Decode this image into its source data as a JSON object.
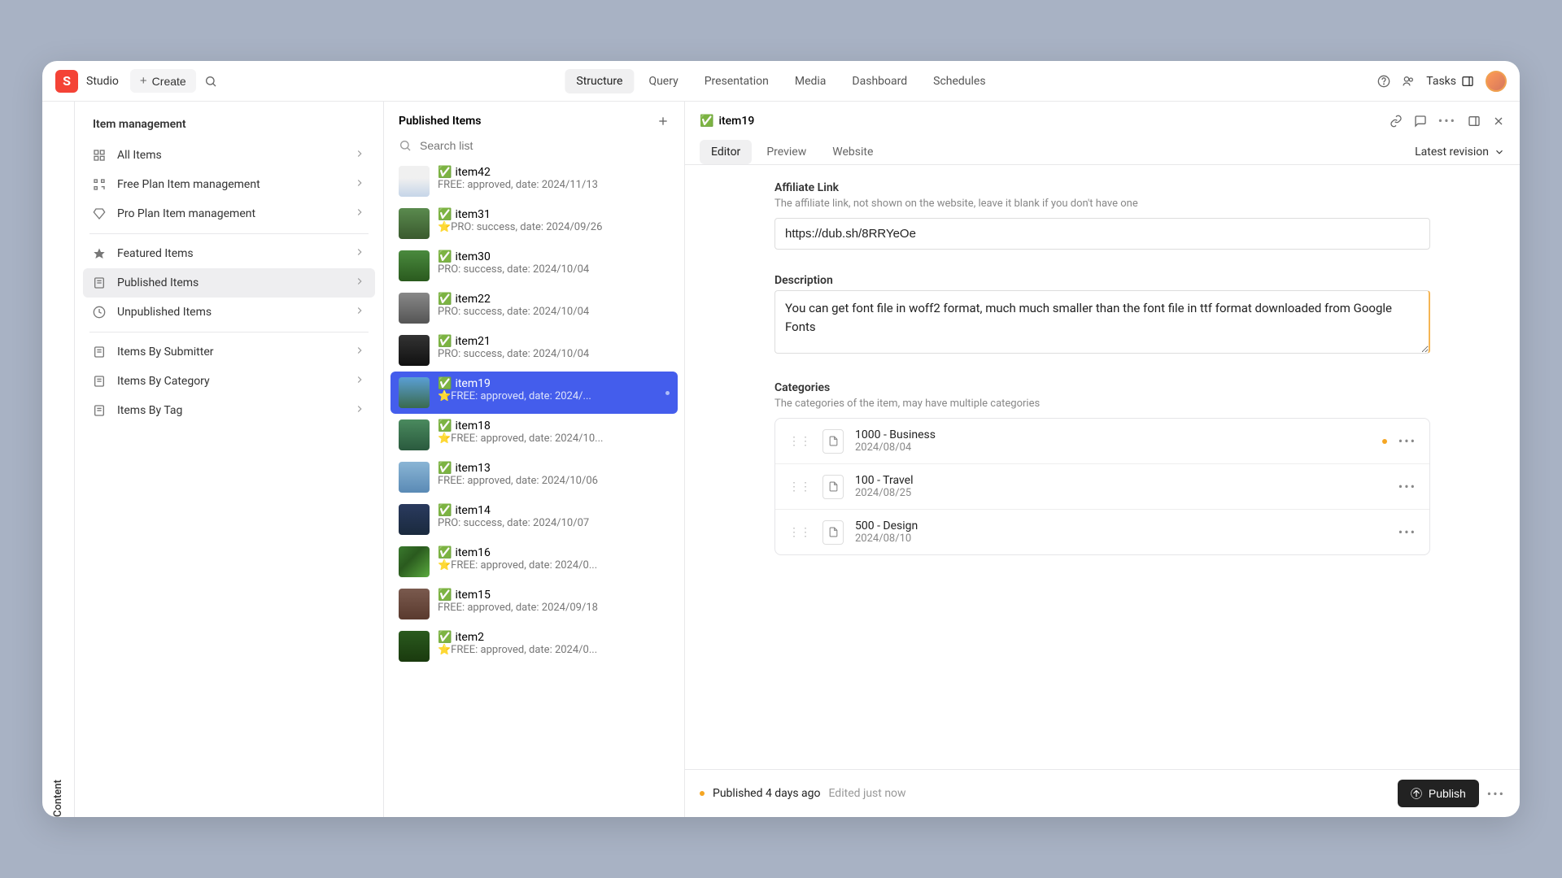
{
  "brand": "Studio",
  "create_label": "Create",
  "nav": [
    "Structure",
    "Query",
    "Presentation",
    "Media",
    "Dashboard",
    "Schedules"
  ],
  "tasks_label": "Tasks",
  "rail_label": "Content",
  "sidebar": {
    "title": "Item management",
    "items": [
      {
        "label": "All Items",
        "icon": "grid"
      },
      {
        "label": "Free Plan Item management",
        "icon": "qr"
      },
      {
        "label": "Pro Plan Item management",
        "icon": "diamond"
      }
    ],
    "items2": [
      {
        "label": "Featured Items",
        "icon": "star"
      },
      {
        "label": "Published Items",
        "icon": "doc",
        "selected": true
      },
      {
        "label": "Unpublished Items",
        "icon": "clock"
      }
    ],
    "items3": [
      {
        "label": "Items By Submitter",
        "icon": "doc"
      },
      {
        "label": "Items By Category",
        "icon": "doc"
      },
      {
        "label": "Items By Tag",
        "icon": "doc"
      }
    ]
  },
  "list": {
    "title": "Published Items",
    "search_placeholder": "Search list",
    "items": [
      {
        "title": "item42",
        "sub": "FREE: approved, date: 2024/11/13"
      },
      {
        "title": "item31",
        "sub": "⭐PRO: success, date: 2024/09/26"
      },
      {
        "title": "item30",
        "sub": "PRO: success, date: 2024/10/04"
      },
      {
        "title": "item22",
        "sub": "PRO: success, date: 2024/10/04"
      },
      {
        "title": "item21",
        "sub": "PRO: success, date: 2024/10/04"
      },
      {
        "title": "item19",
        "sub": "⭐FREE: approved, date: 2024/...",
        "selected": true
      },
      {
        "title": "item18",
        "sub": "⭐FREE: approved, date: 2024/10..."
      },
      {
        "title": "item13",
        "sub": "FREE: approved, date: 2024/10/06"
      },
      {
        "title": "item14",
        "sub": "PRO: success, date: 2024/10/07"
      },
      {
        "title": "item16",
        "sub": "⭐FREE: approved, date: 2024/0..."
      },
      {
        "title": "item15",
        "sub": "FREE: approved, date: 2024/09/18"
      },
      {
        "title": "item2",
        "sub": "⭐FREE: approved, date: 2024/0..."
      }
    ]
  },
  "detail": {
    "title": "item19",
    "tabs": [
      "Editor",
      "Preview",
      "Website"
    ],
    "revision": "Latest revision",
    "affiliate": {
      "label": "Affiliate Link",
      "desc": "The affiliate link, not shown on the website, leave it blank if you don't have one",
      "value": "https://dub.sh/8RRYeOe"
    },
    "description": {
      "label": "Description",
      "value": "You can get font file in woff2 format, much much smaller than the font file in ttf format downloaded from Google Fonts"
    },
    "categories": {
      "label": "Categories",
      "desc": "The categories of the item, may have multiple categories",
      "items": [
        {
          "name": "1000 - Business",
          "date": "2024/08/04",
          "dot": true
        },
        {
          "name": "100 - Travel",
          "date": "2024/08/25"
        },
        {
          "name": "500 - Design",
          "date": "2024/08/10"
        }
      ]
    },
    "footer": {
      "published": "Published 4 days ago",
      "edited": "Edited just now",
      "publish_label": "Publish"
    }
  }
}
